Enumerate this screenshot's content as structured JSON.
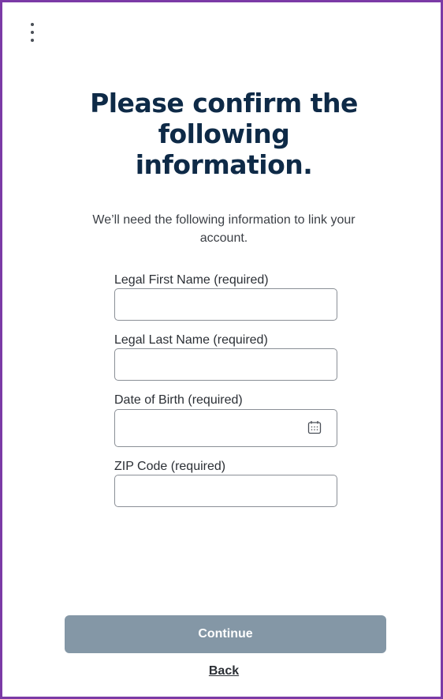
{
  "header": {
    "menu_icon": "more-vertical-icon",
    "title": "Please confirm the following information.",
    "subtitle": "We’ll need the following information to link your account."
  },
  "form": {
    "first_name": {
      "label": "Legal First Name (required)",
      "value": ""
    },
    "last_name": {
      "label": "Legal Last Name (required)",
      "value": ""
    },
    "dob": {
      "label": "Date of Birth (required)",
      "value": "",
      "icon": "calendar-icon"
    },
    "zip": {
      "label": "ZIP Code (required)",
      "value": ""
    }
  },
  "actions": {
    "continue_label": "Continue",
    "back_label": "Back"
  },
  "colors": {
    "frame_border": "#7b3aa6",
    "title": "#0e2a47",
    "button_bg": "#8497a6"
  }
}
